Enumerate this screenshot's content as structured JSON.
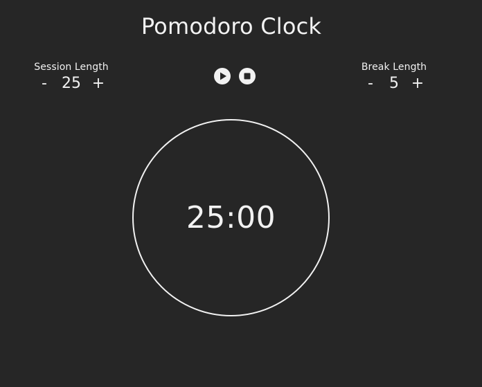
{
  "app": {
    "title": "Pomodoro Clock"
  },
  "session": {
    "label": "Session Length",
    "decrement": "-",
    "value": "25",
    "increment": "+"
  },
  "break": {
    "label": "Break Length",
    "decrement": "-",
    "value": "5",
    "increment": "+"
  },
  "controls": {
    "play_icon": "play-icon",
    "stop_icon": "stop-icon"
  },
  "timer": {
    "display": "25:00"
  },
  "colors": {
    "background": "#262626",
    "foreground": "#f2f2f2"
  }
}
